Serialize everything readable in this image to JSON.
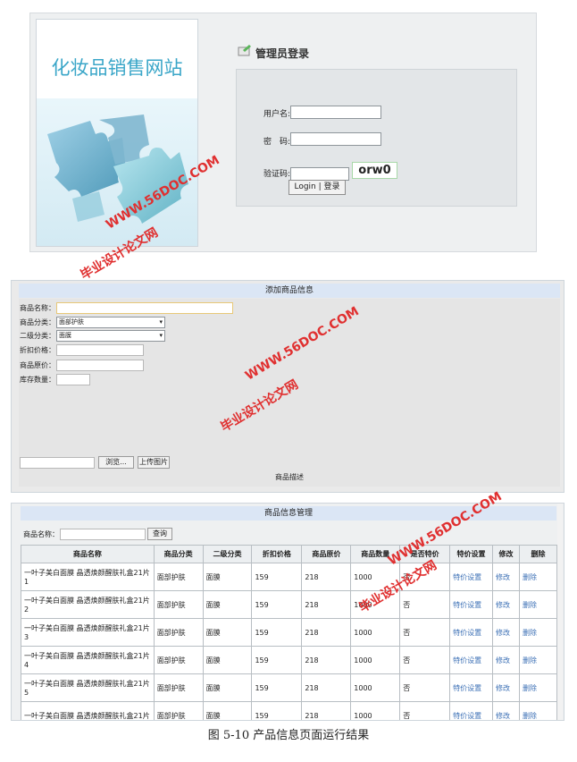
{
  "login_panel": {
    "site_title": "化妆品销售网站",
    "heading": "管理员登录",
    "username_label": "用户名:",
    "password_label": "密　码:",
    "captcha_label": "验证码:",
    "captcha_text": "orw0",
    "login_button": "Login | 登录"
  },
  "add_panel": {
    "title": "添加商品信息",
    "name_label": "商品名称：",
    "category_label": "商品分类：",
    "category_value": "面部护肤",
    "subcategory_label": "二级分类：",
    "subcategory_value": "面膜",
    "discount_label": "折扣价格：",
    "price_label": "商品原价：",
    "stock_label": "库存数量：",
    "browse_button": "浏览...",
    "upload_button": "上传图片",
    "description_label": "商品描述"
  },
  "manage_panel": {
    "title": "商品信息管理",
    "search_label": "商品名称：",
    "search_button": "查询",
    "columns": [
      "商品名称",
      "商品分类",
      "二级分类",
      "折扣价格",
      "商品原价",
      "商品数量",
      "是否特价",
      "特价设置",
      "修改",
      "删除"
    ],
    "rows": [
      [
        "一叶子美白面膜 晶透焕颜醒肤礼盒21片1",
        "面部护肤",
        "面膜",
        "159",
        "218",
        "1000",
        "否",
        "特价设置",
        "修改",
        "删除"
      ],
      [
        "一叶子美白面膜 晶透焕颜醒肤礼盒21片2",
        "面部护肤",
        "面膜",
        "159",
        "218",
        "1000",
        "否",
        "特价设置",
        "修改",
        "删除"
      ],
      [
        "一叶子美白面膜 晶透焕颜醒肤礼盒21片3",
        "面部护肤",
        "面膜",
        "159",
        "218",
        "1000",
        "否",
        "特价设置",
        "修改",
        "删除"
      ],
      [
        "一叶子美白面膜 晶透焕颜醒肤礼盒21片4",
        "面部护肤",
        "面膜",
        "159",
        "218",
        "1000",
        "否",
        "特价设置",
        "修改",
        "删除"
      ],
      [
        "一叶子美白面膜 晶透焕颜醒肤礼盒21片5",
        "面部护肤",
        "面膜",
        "159",
        "218",
        "1000",
        "否",
        "特价设置",
        "修改",
        "删除"
      ],
      [
        "一叶子美白面膜 晶透焕颜醒肤礼盒21片",
        "面部护肤",
        "面膜",
        "159",
        "218",
        "1000",
        "否",
        "特价设置",
        "修改",
        "删除"
      ]
    ]
  },
  "caption": "图 5-10 产品信息页面运行结果",
  "watermarks": {
    "url": "WWW.56DOC.COM",
    "cn": "毕业设计论文网"
  },
  "colors": {
    "accent": "#3aa6c8",
    "header_bar": "#dbe6f5",
    "link": "#3b6fb5",
    "watermark": "#e03030"
  }
}
